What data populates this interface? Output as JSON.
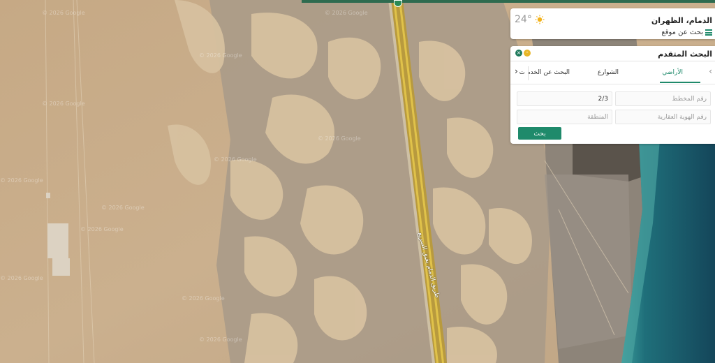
{
  "map": {
    "watermark": "© 2026 Google",
    "road_label": "طريق الدمام بقيق السريع",
    "colors": {
      "sand": "#c9ad86",
      "sand_light": "#d8bf9c",
      "dune_shadow": "#9d8f80",
      "sea": "#1a5363",
      "sea_shallow": "#2f8c8f",
      "road": "#c9a22a"
    }
  },
  "location_card": {
    "title": "الدمام، الظهران",
    "search_label": "بحث عن موقع",
    "temperature": "24°",
    "weather_icon": "sun-icon"
  },
  "search_panel": {
    "title": "البحث المتقدم",
    "tabs": [
      {
        "label": "الأراضي",
        "active": true
      },
      {
        "label": "الشوارع",
        "active": false
      },
      {
        "label": "البحث عن الخدمات",
        "active": false
      }
    ],
    "fields": {
      "plan_number": {
        "placeholder": "رقم المخطط",
        "value": ""
      },
      "plan_value": {
        "placeholder": "",
        "value": "2/3"
      },
      "deed_id": {
        "placeholder": "رقم الهوية العقارية",
        "value": ""
      },
      "region": {
        "placeholder": "المنطقة",
        "value": ""
      }
    },
    "search_button": "بحث",
    "accent": "#1f8a6b"
  }
}
